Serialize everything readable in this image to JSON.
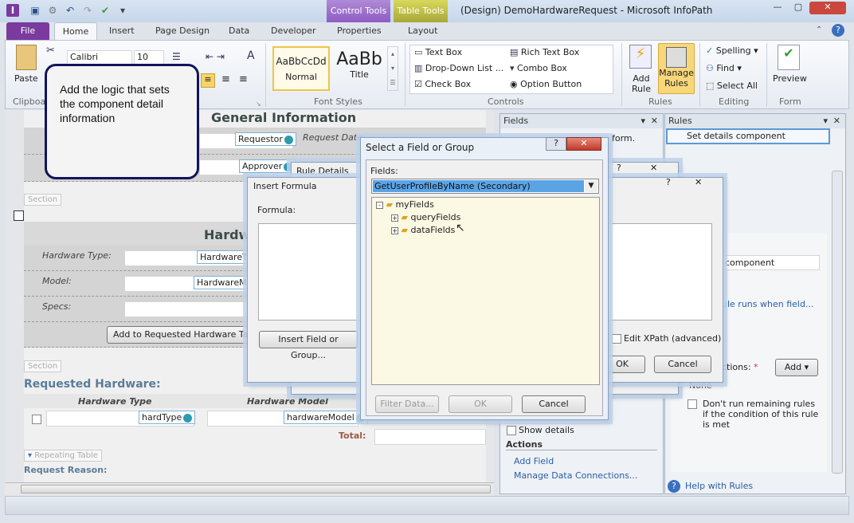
{
  "window": {
    "title": "(Design) DemoHardwareRequest - Microsoft InfoPath",
    "context_tabs": {
      "control_tools": "Control Tools",
      "table_tools": "Table Tools"
    },
    "colors": {
      "file": "#7a3a9e",
      "control_tools": "#8e5cc4",
      "table_tools": "#a8a83a",
      "callout_border": "#12145e"
    }
  },
  "tabs": [
    "File",
    "Home",
    "Insert",
    "Page Design",
    "Data",
    "Developer",
    "Properties",
    "Layout"
  ],
  "ribbon": {
    "clipboard": {
      "paste": "Paste",
      "label": "Clipboard"
    },
    "font": {
      "family": "Calibri",
      "size": "10"
    },
    "font_styles": {
      "normal": "Normal",
      "normal_sample": "AaBbCcDd",
      "title": "Title",
      "title_sample": "AaBb",
      "label": "Font Styles"
    },
    "controls": {
      "items": [
        "Text Box",
        "Rich Text Box",
        "Drop-Down List ...",
        "Combo Box",
        "Check Box",
        "Option Button"
      ],
      "label": "Controls"
    },
    "rules": {
      "add_rule": "Add Rule",
      "manage_rules": "Manage Rules",
      "label": "Rules"
    },
    "editing": {
      "spelling": "Spelling",
      "find": "Find",
      "select_all": "Select All",
      "label": "Editing"
    },
    "form": {
      "preview": "Preview",
      "label": "Form"
    }
  },
  "callout": "Add the logic that sets the component detail information",
  "form": {
    "general_title": "General Information",
    "requestor": "Requestor",
    "request_date": "Request Date:",
    "approver": "Approver",
    "section": "Section",
    "hardware_title": "Hardw",
    "hardware_type_label": "Hardware Type:",
    "hardware_type_field": "HardwareTy",
    "model_label": "Model:",
    "model_field": "HardwareMo",
    "specs_label": "Specs:",
    "add_button": "Add to Requested Hardware Ta",
    "requested_title": "Requested Hardware:",
    "col_type": "Hardware Type",
    "col_model": "Hardware Model",
    "hard_type": "hardType",
    "hardware_model": "hardwareModel",
    "total": "Total:",
    "repeating_table": "Repeating Table",
    "request_reason": "Request Reason:"
  },
  "fields_pane": {
    "title": "Fields",
    "hint": "form.",
    "show_details": "Show details",
    "actions": "Actions",
    "add_field": "Add Field",
    "manage": "Manage Data Connections..."
  },
  "rules_pane": {
    "title": "Rules",
    "selected_rule": "Set details component",
    "name_value": "component",
    "condition_link": "ule runs when field...",
    "actions_label": "ctions:",
    "add": "Add",
    "none": "None",
    "dont_run": "Don't run remaining rules if the condition of this rule is met",
    "help": "Help with Rules"
  },
  "rule_details": {
    "title": "Rule Details",
    "edit_xpath": "Edit XPath (advanced)",
    "ok": "OK",
    "cancel": "Cancel"
  },
  "insert_formula": {
    "title": "Insert Formula",
    "formula_label": "Formula:",
    "insert_field": "Insert Field or Group..."
  },
  "select_field": {
    "title": "Select a Field or Group",
    "fields_label": "Fields:",
    "source": "GetUserProfileByName (Secondary)",
    "tree": [
      {
        "label": "myFields",
        "expander": "-"
      },
      {
        "label": "queryFields",
        "expander": "+"
      },
      {
        "label": "dataFields",
        "expander": "+"
      }
    ],
    "filter": "Filter Data...",
    "ok": "OK",
    "cancel": "Cancel"
  }
}
